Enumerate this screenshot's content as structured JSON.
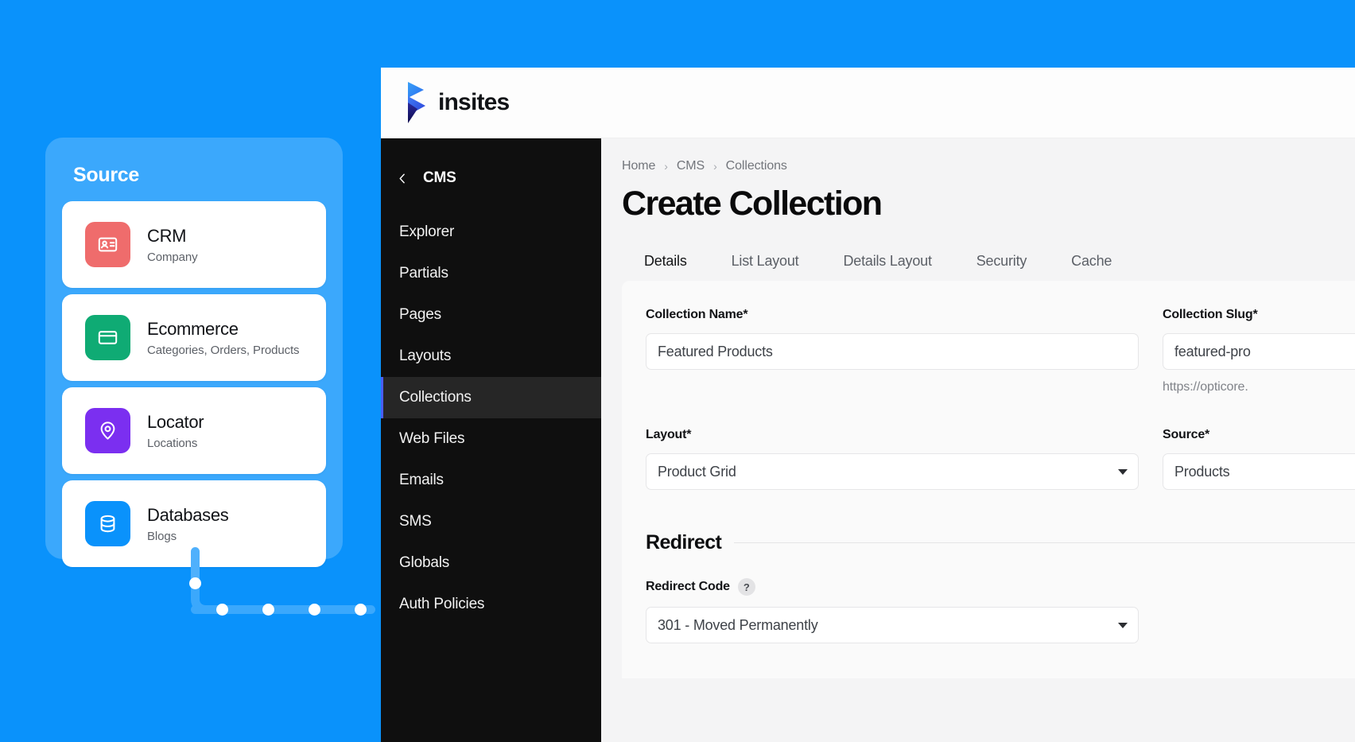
{
  "source_panel": {
    "title": "Source",
    "cards": [
      {
        "name": "CRM",
        "sub": "Company",
        "icon": "contact-card-icon",
        "color": "#ef6c6c"
      },
      {
        "name": "Ecommerce",
        "sub": "Categories, Orders, Products",
        "icon": "credit-card-icon",
        "color": "#0fab74"
      },
      {
        "name": "Locator",
        "sub": "Locations",
        "icon": "map-pin-icon",
        "color": "#7b2ff0"
      },
      {
        "name": "Databases",
        "sub": "Blogs",
        "icon": "database-icon",
        "color": "#0a92fb"
      }
    ]
  },
  "app": {
    "brand": {
      "name": "insites",
      "mark": "insites-logo-icon"
    },
    "sidebar": {
      "back_icon": "chevron-left-icon",
      "title": "CMS",
      "items": [
        {
          "label": "Explorer",
          "active": false
        },
        {
          "label": "Partials",
          "active": false
        },
        {
          "label": "Pages",
          "active": false
        },
        {
          "label": "Layouts",
          "active": false
        },
        {
          "label": "Collections",
          "active": true
        },
        {
          "label": "Web Files",
          "active": false
        },
        {
          "label": "Emails",
          "active": false
        },
        {
          "label": "SMS",
          "active": false
        },
        {
          "label": "Globals",
          "active": false
        },
        {
          "label": "Auth Policies",
          "active": false
        }
      ]
    },
    "main": {
      "breadcrumb": [
        "Home",
        "CMS",
        "Collections"
      ],
      "breadcrumb_separator": "›",
      "page_title": "Create Collection",
      "tabs": [
        {
          "label": "Details",
          "active": true
        },
        {
          "label": "List Layout",
          "active": false
        },
        {
          "label": "Details Layout",
          "active": false
        },
        {
          "label": "Security",
          "active": false
        },
        {
          "label": "Cache",
          "active": false
        }
      ],
      "form": {
        "collection_name": {
          "label": "Collection Name*",
          "value": "Featured Products"
        },
        "collection_slug": {
          "label": "Collection Slug*",
          "value": "featured-pro",
          "help": "https://opticore."
        },
        "layout": {
          "label": "Layout*",
          "value": "Product Grid",
          "icon": "chevron-down-icon"
        },
        "source": {
          "label": "Source*",
          "value": "Products"
        },
        "redirect_section": {
          "title": "Redirect"
        },
        "redirect_code": {
          "label": "Redirect Code",
          "help_icon": "question-mark-icon",
          "help_glyph": "?",
          "value": "301 - Moved Permanently",
          "icon": "chevron-down-icon"
        }
      }
    }
  },
  "colors": {
    "canvas_blue": "#0a92fb",
    "panel_blue": "#3ba8fc",
    "sidebar_black": "#0f0f0f",
    "active_accent": "#4a5ef5",
    "main_bg": "#f4f4f5"
  }
}
